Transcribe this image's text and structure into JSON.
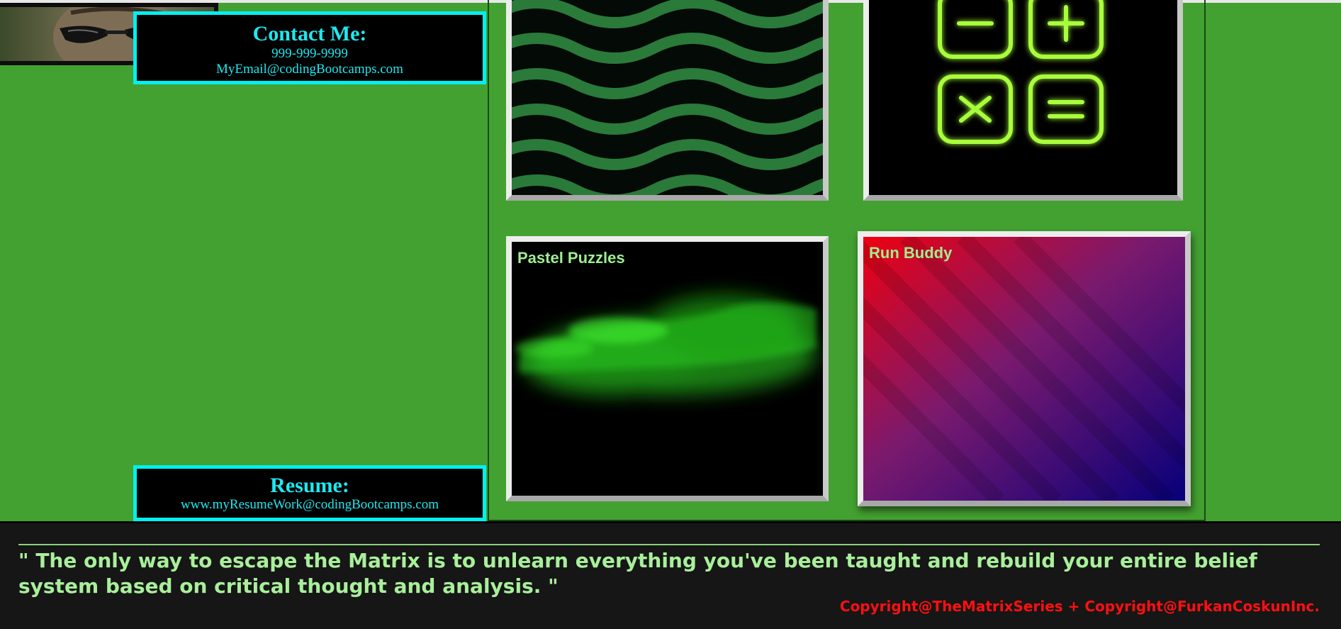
{
  "colors": {
    "page_background": "#43a131",
    "contact_border": "#00f0f0",
    "contact_text": "#1ee8f0",
    "quote_text": "#a9ef9b",
    "copyright_text": "#ff1010"
  },
  "avatar": {
    "icon": "profile-photo-sunglasses"
  },
  "contact": {
    "title": "Contact Me:",
    "phone": "999-999-9999",
    "email": "MyEmail@codingBootcamps.com"
  },
  "resume": {
    "title": "Resume:",
    "link": "www.myResumeWork@codingBootcamps.com"
  },
  "portfolio": {
    "cards": [
      {
        "label": "",
        "image": "green-waves-pattern"
      },
      {
        "label": "",
        "image": "neon-calculator-keys"
      },
      {
        "label": "Pastel Puzzles",
        "image": "green-particle-cloud"
      },
      {
        "label": "Run Buddy",
        "image": "red-blue-gradient-stock"
      }
    ]
  },
  "footer": {
    "quote": "\" The only way to escape the Matrix is to unlearn everything you've been taught and rebuild your entire belief system based on critical thought and analysis. \"",
    "copyright": "Copyright@TheMatrixSeries + Copyright@FurkanCoskunInc."
  }
}
